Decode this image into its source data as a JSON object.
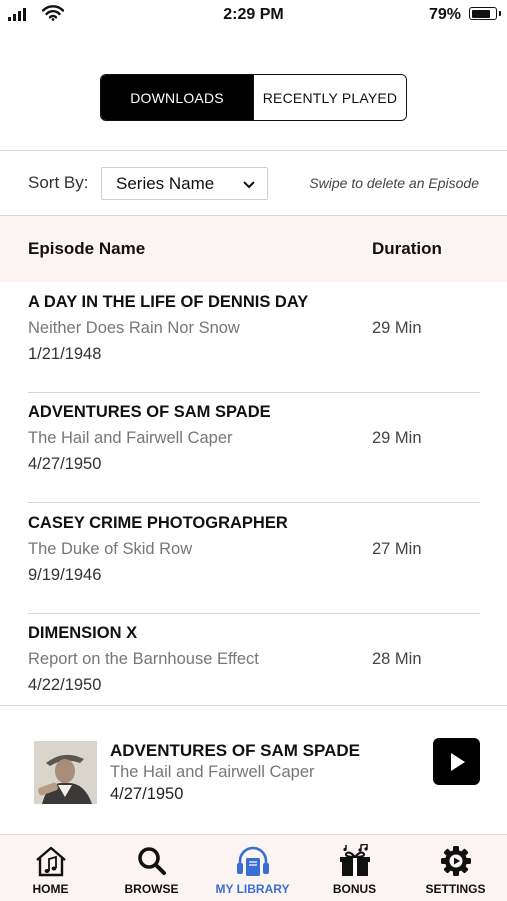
{
  "status": {
    "time": "2:29 PM",
    "battery": "79%",
    "battery_level": 0.79
  },
  "tabs_top": {
    "downloads": "DOWNLOADS",
    "recently_played": "RECENTLY PLAYED",
    "active": "downloads"
  },
  "sort": {
    "label": "Sort By:",
    "value": "Series Name",
    "hint": "Swipe to delete an Episode"
  },
  "table": {
    "col_name": "Episode Name",
    "col_duration": "Duration",
    "rows": [
      {
        "title": "A DAY IN THE LIFE OF DENNIS DAY",
        "subtitle": "Neither Does Rain Nor Snow",
        "date": "1/21/1948",
        "duration": "29 Min"
      },
      {
        "title": "ADVENTURES OF SAM SPADE",
        "subtitle": "The Hail and Fairwell Caper",
        "date": "4/27/1950",
        "duration": "29 Min"
      },
      {
        "title": "CASEY CRIME PHOTOGRAPHER",
        "subtitle": "The Duke of Skid Row",
        "date": "9/19/1946",
        "duration": "27 Min"
      },
      {
        "title": "DIMENSION X",
        "subtitle": "Report on the Barnhouse Effect",
        "date": "4/22/1950",
        "duration": "28 Min"
      }
    ]
  },
  "now_playing": {
    "title": "ADVENTURES OF SAM SPADE",
    "subtitle": "The Hail and Fairwell Caper",
    "date": "4/27/1950"
  },
  "tabbar": {
    "items": [
      {
        "label": "HOME",
        "icon": "home-music-icon"
      },
      {
        "label": "BROWSE",
        "icon": "search-icon"
      },
      {
        "label": "MY LIBRARY",
        "icon": "headphones-book-icon"
      },
      {
        "label": "BONUS",
        "icon": "bonus-music-icon"
      },
      {
        "label": "SETTINGS",
        "icon": "gear-icon"
      }
    ],
    "active": "MY LIBRARY",
    "active_color": "#3a6fd1"
  }
}
